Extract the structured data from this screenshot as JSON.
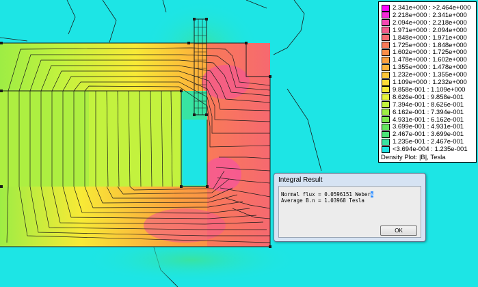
{
  "legend": {
    "entries": [
      {
        "label": "2.341e+000 : >2.464e+000",
        "color": "#ff00ff"
      },
      {
        "label": "2.218e+000 : 2.341e+000",
        "color": "#f72ad8"
      },
      {
        "label": "2.094e+000 : 2.218e+000",
        "color": "#f548b2"
      },
      {
        "label": "1.971e+000 : 2.094e+000",
        "color": "#f45a8c"
      },
      {
        "label": "1.848e+000 : 1.971e+000",
        "color": "#f66970"
      },
      {
        "label": "1.725e+000 : 1.848e+000",
        "color": "#f97a58"
      },
      {
        "label": "1.602e+000 : 1.725e+000",
        "color": "#fb8d48"
      },
      {
        "label": "1.478e+000 : 1.602e+000",
        "color": "#fca03e"
      },
      {
        "label": "1.355e+000 : 1.478e+000",
        "color": "#fdb33a"
      },
      {
        "label": "1.232e+000 : 1.355e+000",
        "color": "#fdc637"
      },
      {
        "label": "1.109e+000 : 1.232e+000",
        "color": "#fcd937"
      },
      {
        "label": "9.858e-001 : 1.109e+000",
        "color": "#f8ea36"
      },
      {
        "label": "8.626e-001 : 9.858e-001",
        "color": "#e6f43a"
      },
      {
        "label": "7.394e-001 : 8.626e-001",
        "color": "#c3f23e"
      },
      {
        "label": "6.162e-001 : 7.394e-001",
        "color": "#9eed44"
      },
      {
        "label": "4.931e-001 : 6.162e-001",
        "color": "#7ee94e"
      },
      {
        "label": "3.699e-001 : 4.931e-001",
        "color": "#63e55e"
      },
      {
        "label": "2.467e-001 : 3.699e-001",
        "color": "#4ce478"
      },
      {
        "label": "1.235e-001 : 2.467e-001",
        "color": "#38e4a2"
      },
      {
        "label": "<3.694e-004 : 1.235e-001",
        "color": "#1de5e5"
      }
    ],
    "caption": "Density Plot: |B|, Tesla"
  },
  "dialog": {
    "title": "Integral Result",
    "line1_label": "Normal flux = 0.0596151 Weber",
    "line1_selected": "s",
    "line2": "Average B.n = 1.03968 Tesla",
    "ok_label": "OK"
  }
}
